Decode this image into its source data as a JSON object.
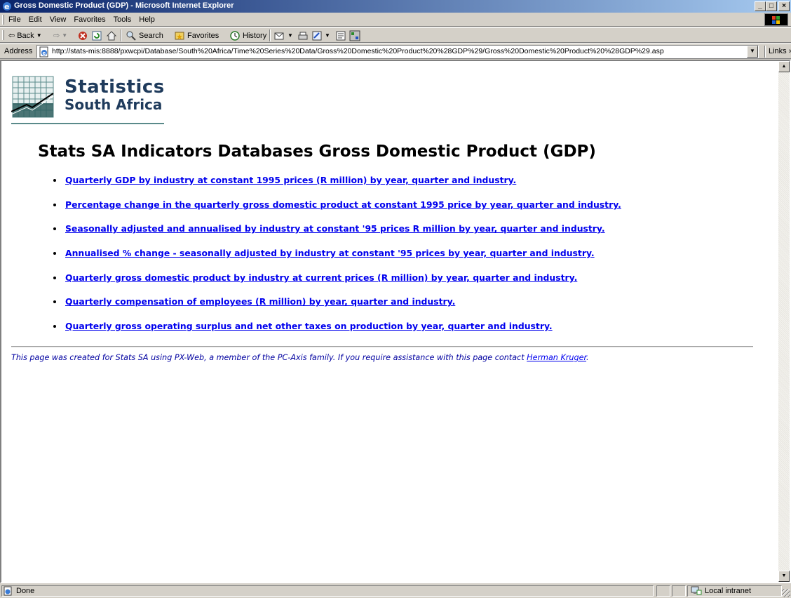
{
  "window": {
    "title": "Gross Domestic Product (GDP) - Microsoft Internet Explorer",
    "buttons": {
      "minimize": "_",
      "maximize": "□",
      "close": "×"
    }
  },
  "menu": {
    "items": [
      "File",
      "Edit",
      "View",
      "Favorites",
      "Tools",
      "Help"
    ]
  },
  "toolbar": {
    "back_label": "Back",
    "search_label": "Search",
    "favorites_label": "Favorites",
    "history_label": "History"
  },
  "address": {
    "label": "Address",
    "url": "http://stats-mis:8888/pxwcpi/Database/South%20Africa/Time%20Series%20Data/Gross%20Domestic%20Product%20%28GDP%29/Gross%20Domestic%20Product%20%28GDP%29.asp",
    "links_label": "Links »"
  },
  "logo": {
    "line1": "Statistics",
    "line2": "South Africa"
  },
  "page": {
    "title": "Stats SA Indicators Databases Gross Domestic Product (GDP)",
    "links": [
      "Quarterly GDP by industry at constant 1995 prices (R million) by year, quarter and industry.",
      "Percentage change in the quarterly gross domestic product at constant 1995 price by year, quarter and industry.",
      "Seasonally adjusted and annualised by industry at constant '95 prices R million by year, quarter and industry.",
      "Annualised % change - seasonally adjusted by industry at constant '95 prices by year, quarter and industry.",
      "Quarterly gross domestic product by industry at current prices (R million) by year, quarter and industry.",
      "Quarterly compensation of employees (R million) by year, quarter and industry.",
      "Quarterly gross operating surplus and net other taxes on production by year, quarter and industry."
    ],
    "footer_text": "This page was created for Stats SA using PX-Web, a member of the PC-Axis family. If you require assistance with this page contact ",
    "footer_contact": "Herman Kruger",
    "footer_end": "."
  },
  "status": {
    "text": "Done",
    "zone": "Local intranet"
  },
  "colors": {
    "link": "#0000ee",
    "titlebar_start": "#0a246a",
    "titlebar_end": "#a6caf0",
    "logo_text": "#1f3b5c"
  }
}
